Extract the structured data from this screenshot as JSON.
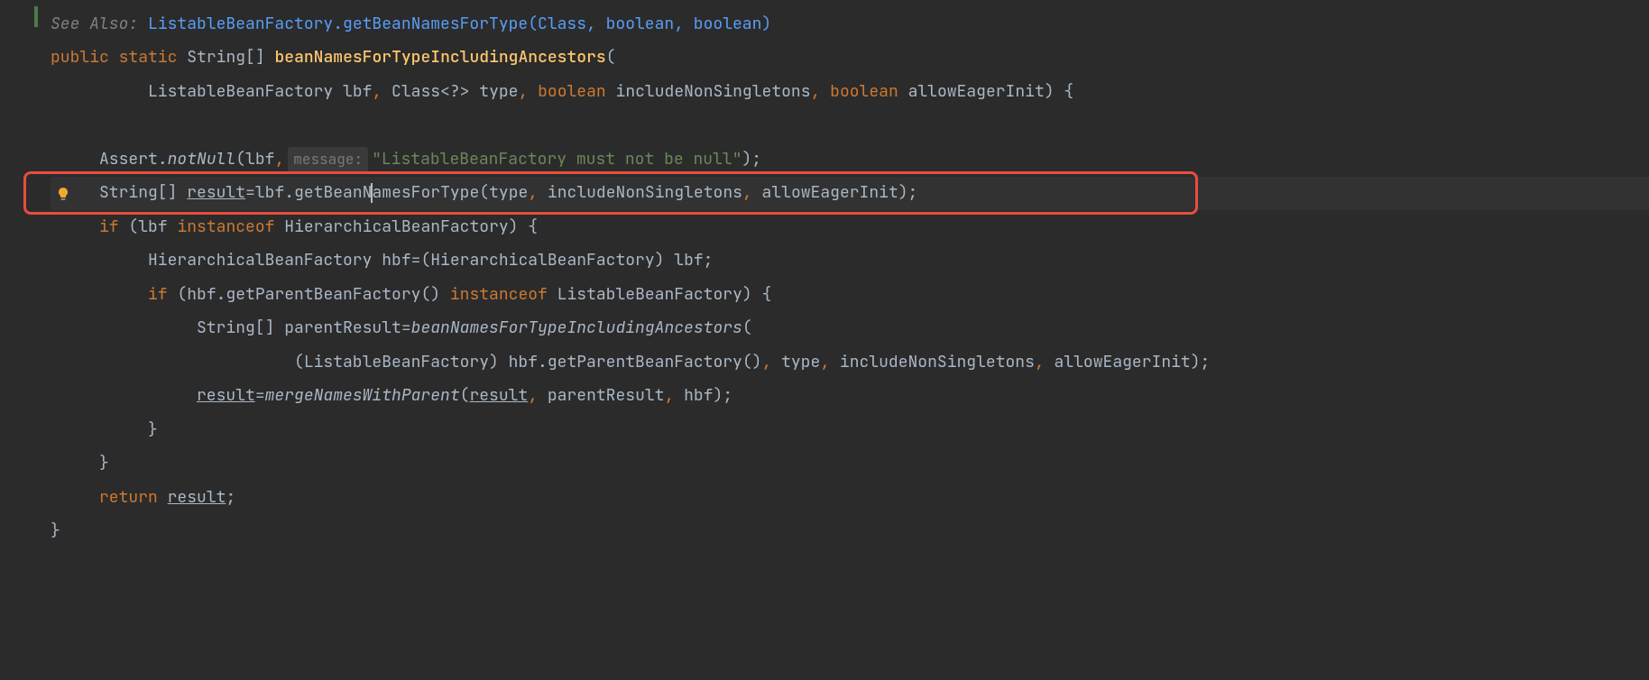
{
  "code": {
    "see_also_label": "See Also:",
    "see_also_link": "ListableBeanFactory.getBeanNamesForType(Class, boolean, boolean)",
    "kw_public": "public",
    "kw_static": "static",
    "kw_boolean": "boolean",
    "kw_if": "if",
    "kw_instanceof": "instanceof",
    "kw_return": "return",
    "type_string_arr": "String[]",
    "type_class_wild": "Class<?>",
    "type_listable_bf": "ListableBeanFactory",
    "type_hier_bf": "HierarchicalBeanFactory",
    "method_def": "beanNamesForTypeIncludingAncestors",
    "method_getBeanNamesForType": "getBeanNamesForType",
    "method_getParentBeanFactory": "getParentBeanFactory",
    "method_mergeNamesWithParent": "mergeNamesWithParent",
    "param_lbf": "lbf",
    "param_type": "type",
    "param_includeNonSingletons": "includeNonSingletons",
    "param_allowEagerInit": "allowEagerInit",
    "var_result": "result",
    "var_hbf": "hbf",
    "var_parentResult": "parentResult",
    "assert_class": "Assert",
    "assert_notnull": "notNull",
    "hint_message": "message:",
    "string_notnull": "\"ListableBeanFactory must not be null\"",
    "punct_open_paren": "(",
    "punct_close_paren": ")",
    "punct_open_brace": "{",
    "punct_close_brace": "}",
    "punct_semicolon": ";",
    "punct_dot": ".",
    "punct_comma": ",",
    "punct_equals": " = ",
    "punct_close_paren_semi": ");",
    "punct_close_paren_brace": ") {"
  },
  "colors": {
    "highlight_border": "#e84d3d"
  }
}
